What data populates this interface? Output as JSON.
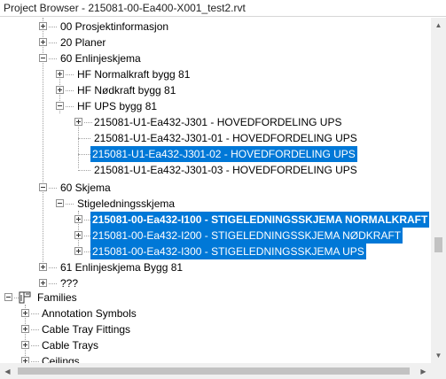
{
  "window": {
    "title": "Project Browser - 215081-00-Ea400-X001_test2.rvt"
  },
  "tree": {
    "items": [
      {
        "label": "00 Prosjektinformasjon",
        "state": "collapsed",
        "selected": false,
        "bold": false
      },
      {
        "label": "20 Planer",
        "state": "collapsed",
        "selected": false,
        "bold": false
      },
      {
        "label": "60 Enlinjeskjema",
        "state": "expanded",
        "selected": false,
        "bold": false
      },
      {
        "label": "HF Normalkraft bygg 81",
        "state": "collapsed",
        "selected": false,
        "bold": false
      },
      {
        "label": "HF Nødkraft bygg 81",
        "state": "collapsed",
        "selected": false,
        "bold": false
      },
      {
        "label": "HF UPS bygg 81",
        "state": "expanded",
        "selected": false,
        "bold": false
      },
      {
        "label": "215081-U1-Ea432-J301 - HOVEDFORDELING UPS",
        "state": "collapsed",
        "selected": false,
        "bold": false
      },
      {
        "label": "215081-U1-Ea432-J301-01 - HOVEDFORDELING UPS",
        "state": "leaf",
        "selected": false,
        "bold": false
      },
      {
        "label": "215081-U1-Ea432-J301-02 - HOVEDFORDELING UPS",
        "state": "leaf",
        "selected": true,
        "bold": false
      },
      {
        "label": "215081-U1-Ea432-J301-03 - HOVEDFORDELING UPS",
        "state": "leaf",
        "selected": false,
        "bold": false
      },
      {
        "label": "60 Skjema",
        "state": "expanded",
        "selected": false,
        "bold": false
      },
      {
        "label": "Stigeledningsskjema",
        "state": "expanded",
        "selected": false,
        "bold": false
      },
      {
        "label": "215081-00-Ea432-I100 - STIGELEDNINGSSKJEMA NORMALKRAFT",
        "state": "collapsed",
        "selected": true,
        "bold": true
      },
      {
        "label": "215081-00-Ea432-I200 - STIGELEDNINGSSKJEMA NØDKRAFT",
        "state": "collapsed",
        "selected": true,
        "bold": false
      },
      {
        "label": "215081-00-Ea432-I300 - STIGELEDNINGSSKJEMA UPS",
        "state": "collapsed",
        "selected": true,
        "bold": false
      },
      {
        "label": "61 Enlinjeskjema Bygg 81",
        "state": "collapsed",
        "selected": false,
        "bold": false
      },
      {
        "label": "???",
        "state": "collapsed",
        "selected": false,
        "bold": false
      },
      {
        "label": "Families",
        "state": "expanded",
        "selected": false,
        "bold": false,
        "icon": "families-icon"
      },
      {
        "label": "Annotation Symbols",
        "state": "collapsed",
        "selected": false,
        "bold": false
      },
      {
        "label": "Cable Tray Fittings",
        "state": "collapsed",
        "selected": false,
        "bold": false
      },
      {
        "label": "Cable Trays",
        "state": "collapsed",
        "selected": false,
        "bold": false
      },
      {
        "label": "Ceilings",
        "state": "collapsed",
        "selected": false,
        "bold": false
      }
    ]
  },
  "colors": {
    "selection": "#0078d7",
    "selection_text": "#ffffff",
    "connector": "#a0a0a0"
  },
  "scrollbars": {
    "vertical_position": 0.66,
    "horizontal_position": 0.0
  }
}
